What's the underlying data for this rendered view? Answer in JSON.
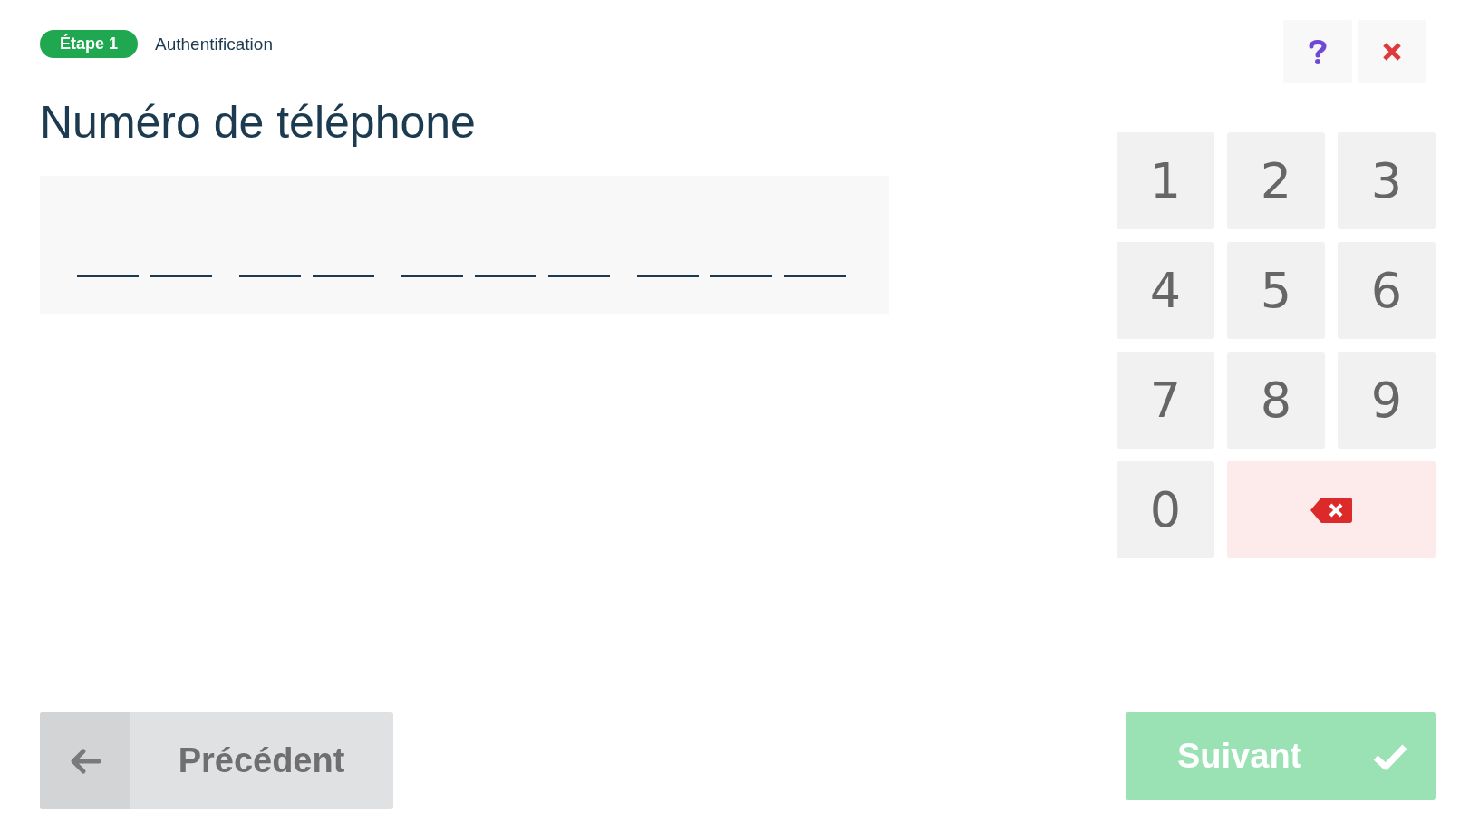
{
  "step": {
    "badge": "Étape 1",
    "label": "Authentification"
  },
  "top_buttons": [
    {
      "kind": "help"
    },
    {
      "kind": "close"
    }
  ],
  "title": "Numéro de téléphone",
  "phone_field": {
    "groups": [
      {
        "kind": "pair"
      },
      {
        "kind": "pair"
      },
      {
        "kind": "triple"
      },
      {
        "kind": "triple"
      }
    ]
  },
  "keypad": [
    {
      "kind": "digit",
      "label": "1"
    },
    {
      "kind": "digit",
      "label": "2"
    },
    {
      "kind": "digit",
      "label": "3"
    },
    {
      "kind": "digit",
      "label": "4"
    },
    {
      "kind": "digit",
      "label": "5"
    },
    {
      "kind": "digit",
      "label": "6"
    },
    {
      "kind": "digit",
      "label": "7"
    },
    {
      "kind": "digit",
      "label": "8"
    },
    {
      "kind": "digit",
      "label": "9"
    },
    {
      "kind": "digit",
      "label": "0"
    },
    {
      "kind": "backspace"
    }
  ],
  "previous_button": {
    "label": "Précédent",
    "disabled": false
  },
  "next_button": {
    "label": "Suivant",
    "disabled": true
  }
}
